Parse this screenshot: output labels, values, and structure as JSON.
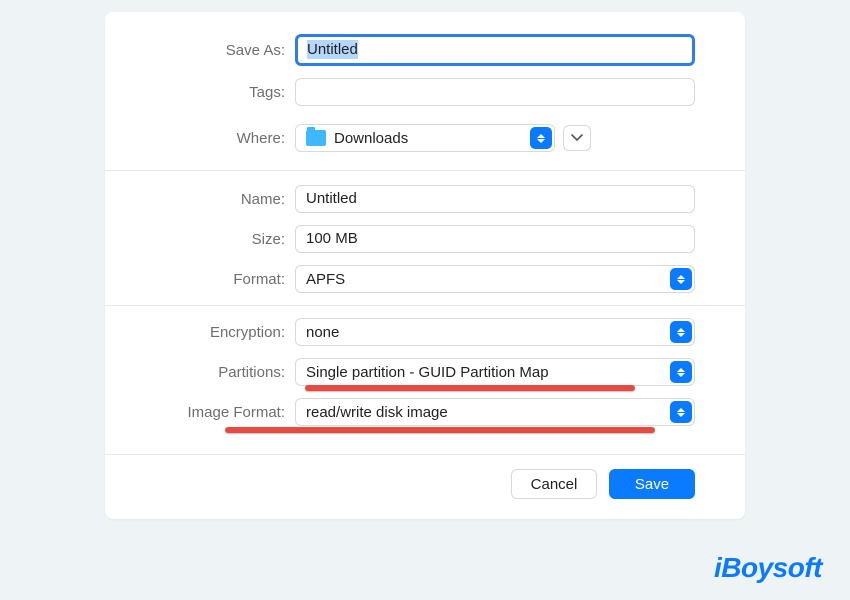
{
  "labels": {
    "save_as": "Save As:",
    "tags": "Tags:",
    "where": "Where:",
    "name": "Name:",
    "size": "Size:",
    "format": "Format:",
    "encryption": "Encryption:",
    "partitions": "Partitions:",
    "image_format": "Image Format:"
  },
  "values": {
    "save_as": "Untitled",
    "tags": "",
    "where": "Downloads",
    "name": "Untitled",
    "size": "100 MB",
    "format": "APFS",
    "encryption": "none",
    "partitions": "Single partition - GUID Partition Map",
    "image_format": "read/write disk image"
  },
  "buttons": {
    "cancel": "Cancel",
    "save": "Save"
  },
  "watermark": "iBoysoft"
}
